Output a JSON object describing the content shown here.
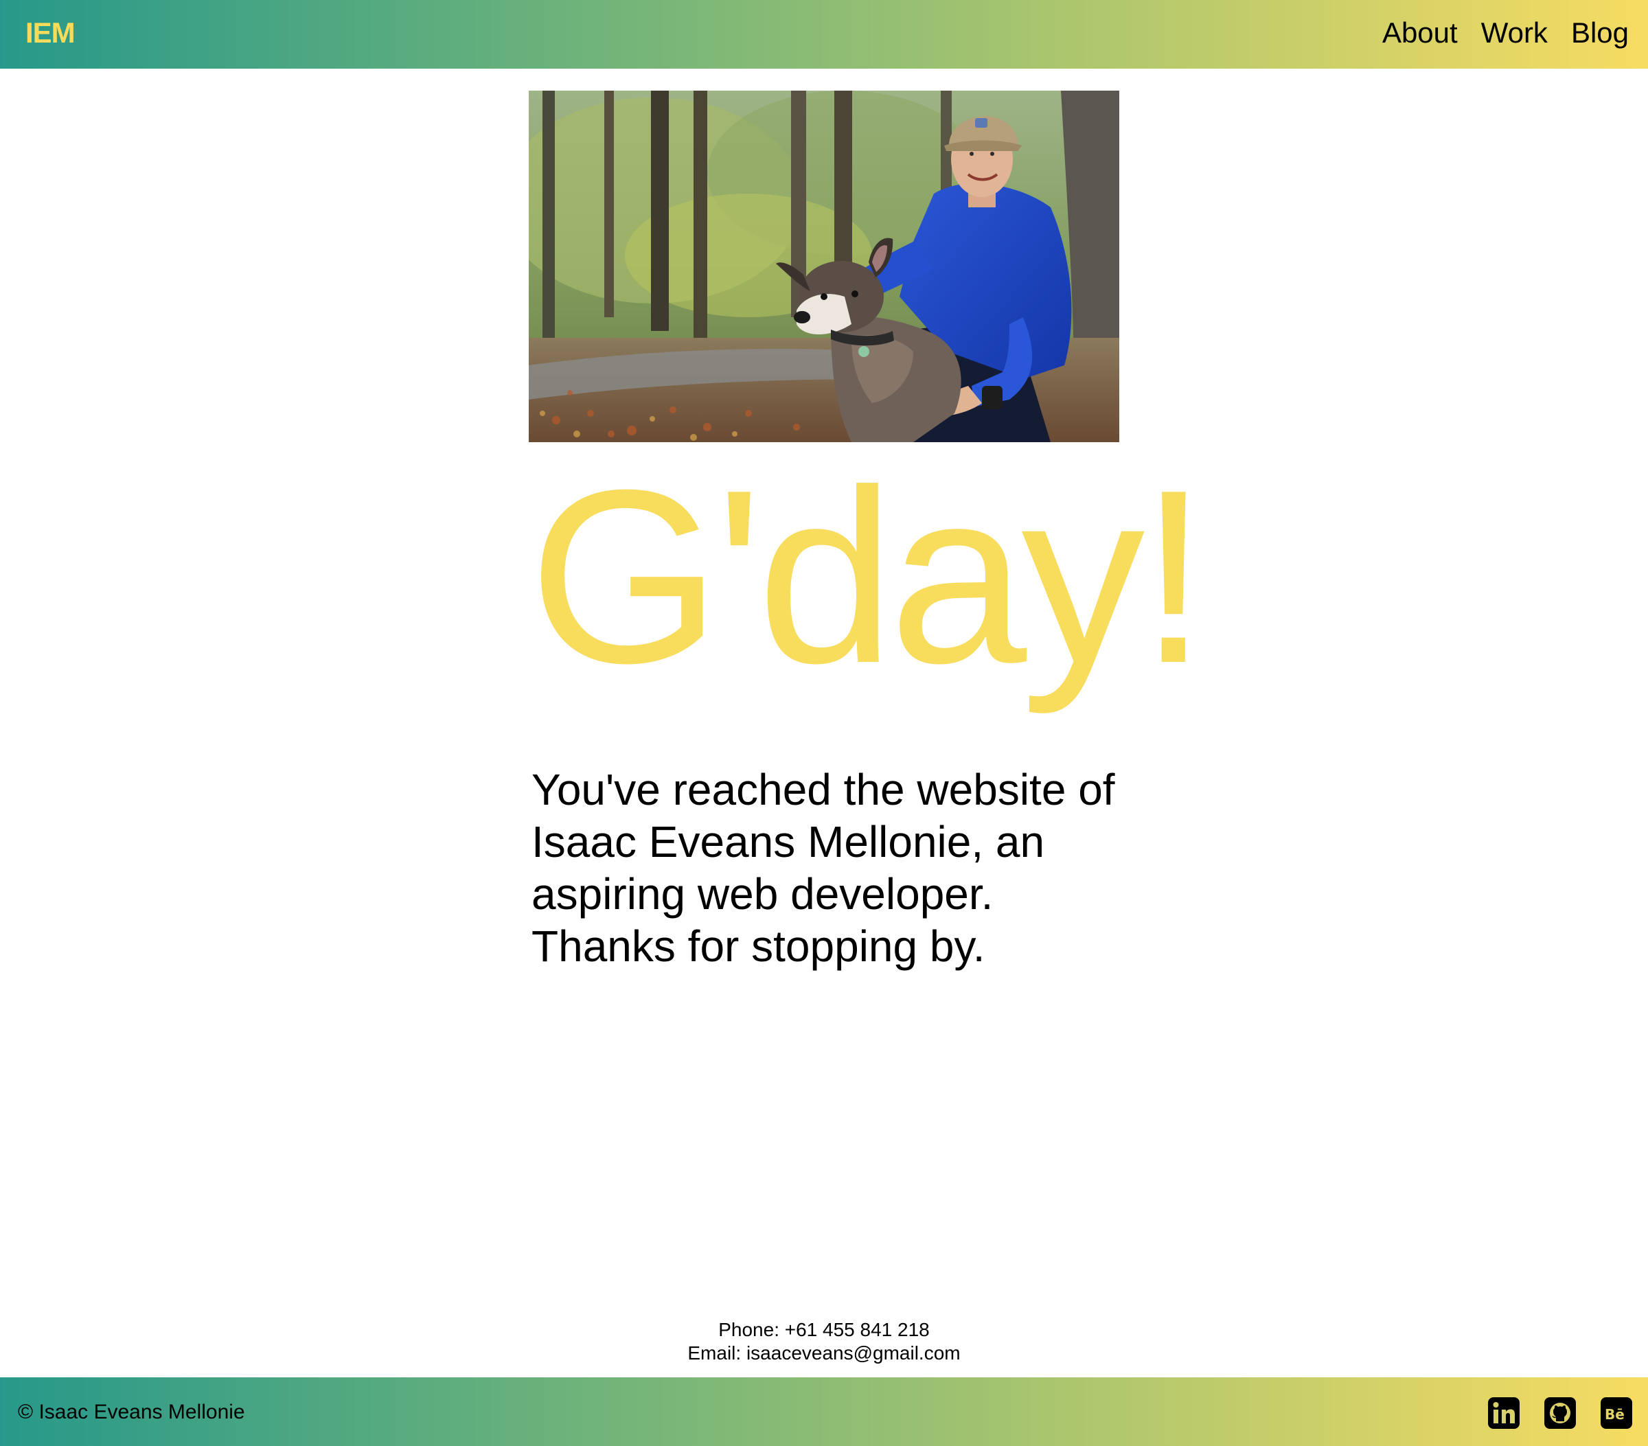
{
  "header": {
    "logo": "IEM",
    "nav": [
      {
        "label": "About"
      },
      {
        "label": "Work"
      },
      {
        "label": "Blog"
      }
    ]
  },
  "hero": {
    "photo_subject": "man-with-dog-in-forest"
  },
  "main": {
    "greeting": "G'day!",
    "intro": "You've reached the website of Isaac Eveans Mellonie, an aspiring web developer. Thanks for stopping by."
  },
  "contact": {
    "phone": "Phone: +61 455 841 218",
    "email": "Email: isaaceveans@gmail.com"
  },
  "footer": {
    "copyright": "© Isaac Eveans Mellonie",
    "social_icons": [
      "linkedin-icon",
      "github-icon",
      "behance-icon"
    ]
  },
  "colors": {
    "gradient_start": "#27998a",
    "gradient_end": "#f7dc62",
    "accent_yellow": "#f8dc5c"
  }
}
